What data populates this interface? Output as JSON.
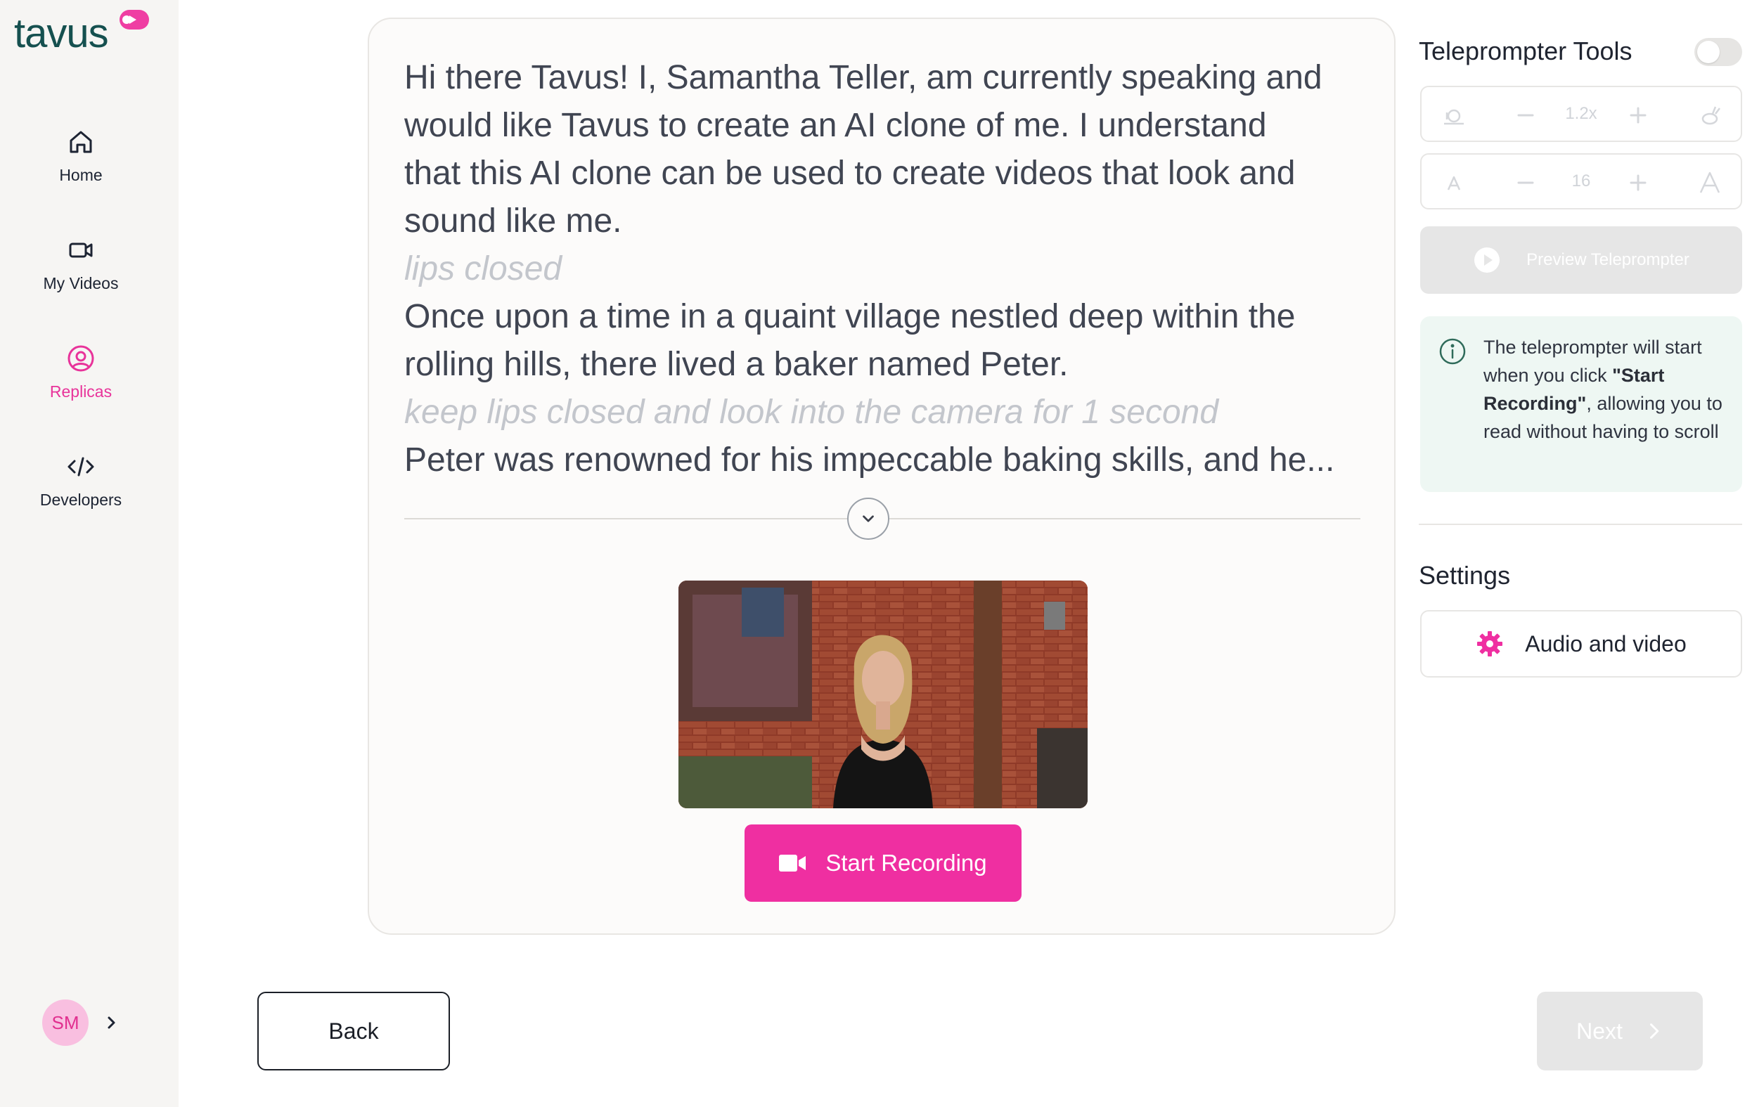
{
  "app": {
    "logo_text": "tavus"
  },
  "sidebar": {
    "items": [
      {
        "label": "Home",
        "icon": "home-icon",
        "active": false
      },
      {
        "label": "My Videos",
        "icon": "video-camera-icon",
        "active": false
      },
      {
        "label": "Replicas",
        "icon": "user-circle-icon",
        "active": true
      },
      {
        "label": "Developers",
        "icon": "code-icon",
        "active": false
      }
    ],
    "user_initials": "SM"
  },
  "script": {
    "lines": [
      {
        "text": "Hi there Tavus! I, Samantha Teller, am currently speaking and",
        "cue": false
      },
      {
        "text": "would like Tavus to create an AI clone of me. I understand",
        "cue": false
      },
      {
        "text": "that this AI clone can be used to create videos that look and",
        "cue": false
      },
      {
        "text": "sound like me.",
        "cue": false
      },
      {
        "text": "lips closed",
        "cue": true
      },
      {
        "text": "Once upon a time in a quaint village nestled deep within the",
        "cue": false
      },
      {
        "text": "rolling hills, there lived a baker named Peter.",
        "cue": false
      },
      {
        "text": "keep lips closed and look into the camera for 1 second",
        "cue": true
      },
      {
        "text": "Peter was renowned for his impeccable baking skills, and he...",
        "cue": false
      }
    ]
  },
  "recording": {
    "start_label": "Start Recording"
  },
  "teleprompter": {
    "title": "Teleprompter Tools",
    "enabled": false,
    "speed_value": "1.2x",
    "font_size_value": "16",
    "preview_label": "Preview Teleprompter",
    "info_before": "The teleprompter will start when you click ",
    "info_bold": "\"Start Recording\"",
    "info_after": ", allowing you to read without having to scroll"
  },
  "settings": {
    "title": "Settings",
    "audio_video_label": "Audio and video"
  },
  "footer": {
    "back_label": "Back",
    "next_label": "Next"
  },
  "colors": {
    "accent": "#ef2fa1",
    "brand_dark": "#15504f",
    "info_bg": "#eef7f3"
  }
}
